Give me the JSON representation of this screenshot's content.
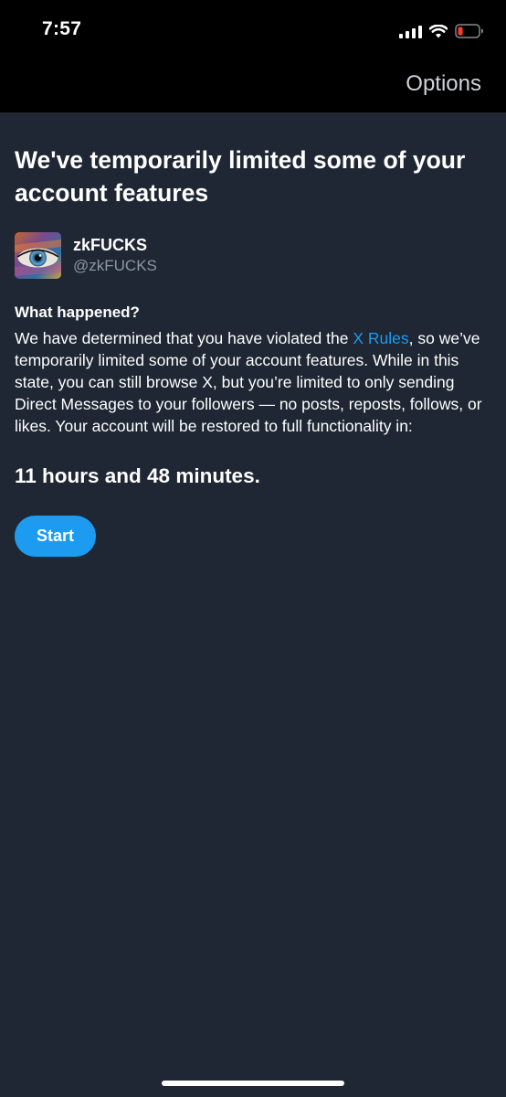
{
  "status_bar": {
    "time": "7:57"
  },
  "header": {
    "options_label": "Options"
  },
  "notice": {
    "title": "We've temporarily limited some of your account features",
    "profile": {
      "display_name": "zkFUCKS",
      "handle": "@zkFUCKS"
    },
    "section_heading": "What happened?",
    "body_before_link": "We have determined that you have violated the ",
    "rules_link": "X Rules",
    "body_after_link": ", so we’ve temporarily limited some of your account features. While in this state, you can still browse X, but you’re limited to only sending Direct Messages to your followers — no posts, reposts, follows, or likes. Your account will be restored to full functionality in:",
    "countdown": "11 hours and 48 minutes.",
    "start_label": "Start"
  },
  "colors": {
    "background": "#1e2733",
    "accent": "#1d9bf0",
    "secondary_text": "#8b98a5",
    "battery_low": "#ff3b30"
  }
}
